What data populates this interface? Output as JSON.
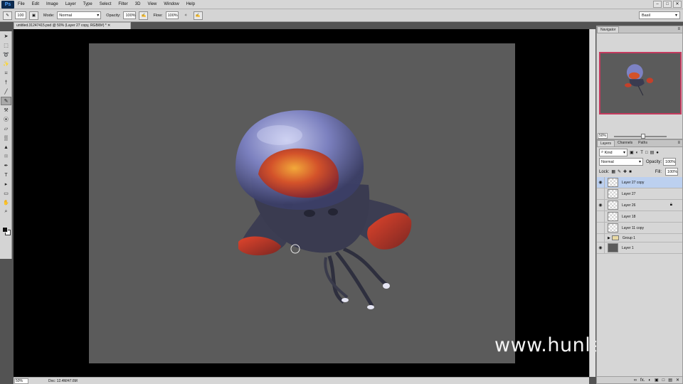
{
  "app": {
    "logo": "Ps"
  },
  "menu": [
    "File",
    "Edit",
    "Image",
    "Layer",
    "Type",
    "Select",
    "Filter",
    "3D",
    "View",
    "Window",
    "Help"
  ],
  "window_controls": [
    "–",
    "□",
    "✕"
  ],
  "options": {
    "brush_size": "100",
    "mode_label": "Mode:",
    "mode_value": "Normal",
    "opacity_label": "Opacity:",
    "opacity_value": "100%",
    "flow_label": "Flow:",
    "flow_value": "100%",
    "workspace": "Basil"
  },
  "tools": [
    "➤",
    "⬚",
    "➰",
    "✨",
    "⌑",
    "†",
    "╱",
    "✎",
    "⚒",
    "⦿",
    "▱",
    "▒",
    "▲",
    "☉",
    "✒",
    "T",
    "▸",
    "▭",
    "✋",
    "⌕"
  ],
  "document": {
    "tab_title": "untitled.31247415.psd @ 50% (Layer 27 copy, RGB/8#) *",
    "status_zoom": "50%",
    "status_doc": "Doc: 12.4M/47.6M"
  },
  "watermark": "www.hunls.com",
  "navigator": {
    "tab": "Navigator",
    "zoom": "50%"
  },
  "layers_panel": {
    "tabs": [
      "Layers",
      "Channels",
      "Paths"
    ],
    "kind": "Kind",
    "blend_mode": "Normal",
    "opacity_label": "Opacity:",
    "opacity_value": "100%",
    "lock_label": "Lock:",
    "fill_label": "Fill:",
    "fill_value": "100%",
    "layers": [
      {
        "name": "Layer 27 copy",
        "visible": true,
        "selected": true
      },
      {
        "name": "Layer 27",
        "visible": false
      },
      {
        "name": "Layer 26",
        "visible": true,
        "locked": true
      },
      {
        "name": "Layer 18",
        "visible": false
      },
      {
        "name": "Layer 11 copy",
        "visible": false
      },
      {
        "name": "Group 1",
        "visible": false,
        "group": true
      },
      {
        "name": "Layer 1",
        "visible": true,
        "fill": "gray"
      }
    ],
    "bottom_icons": [
      "∞",
      "fx.",
      "◐",
      "▣",
      "□",
      "▤",
      "✕"
    ]
  },
  "colors": {
    "canvas": "#5b5b5b",
    "navigator_frame": "#c43a5e",
    "selected_layer": "#bcd0ef"
  }
}
